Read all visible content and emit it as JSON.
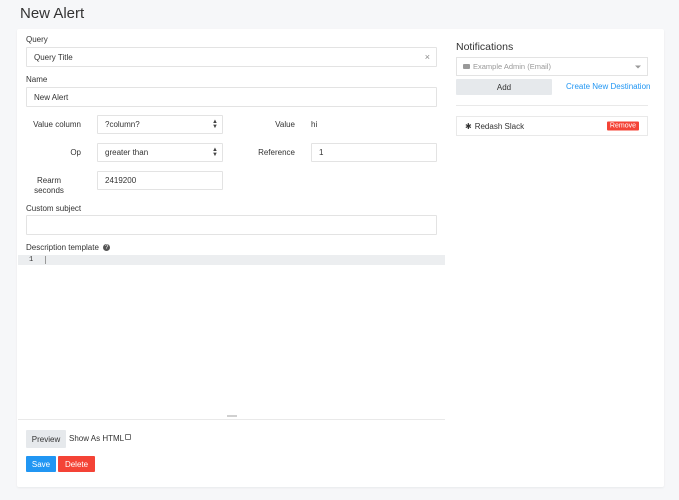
{
  "page": {
    "title": "New Alert"
  },
  "form": {
    "query_label": "Query",
    "query_value": "Query Title",
    "query_clear_icon": "×",
    "name_label": "Name",
    "name_value": "New Alert",
    "value_column_label": "Value column",
    "value_column_selected": "?column?",
    "value_label": "Value",
    "value_value": "hi",
    "op_label": "Op",
    "op_selected": "greater than",
    "reference_label": "Reference",
    "reference_value": "1",
    "rearm_label_line1": "Rearm",
    "rearm_label_line2": "seconds",
    "rearm_value": "2419200",
    "custom_subject_label": "Custom subject",
    "custom_subject_value": "",
    "description_label": "Description template",
    "help_icon": "?",
    "editor_line_number": "1",
    "preview_label": "Preview",
    "show_as_html_label": "Show As HTML",
    "save_label": "Save",
    "delete_label": "Delete"
  },
  "notifications": {
    "title": "Notifications",
    "destination_placeholder": "Example Admin (Email)",
    "add_label": "Add",
    "create_new_label": "Create New Destination",
    "destinations": [
      {
        "name": "Redash Slack",
        "remove_label": "Remove"
      }
    ]
  },
  "colors": {
    "primary": "#2196f3",
    "danger": "#f44336",
    "background": "#f6f7f9"
  }
}
